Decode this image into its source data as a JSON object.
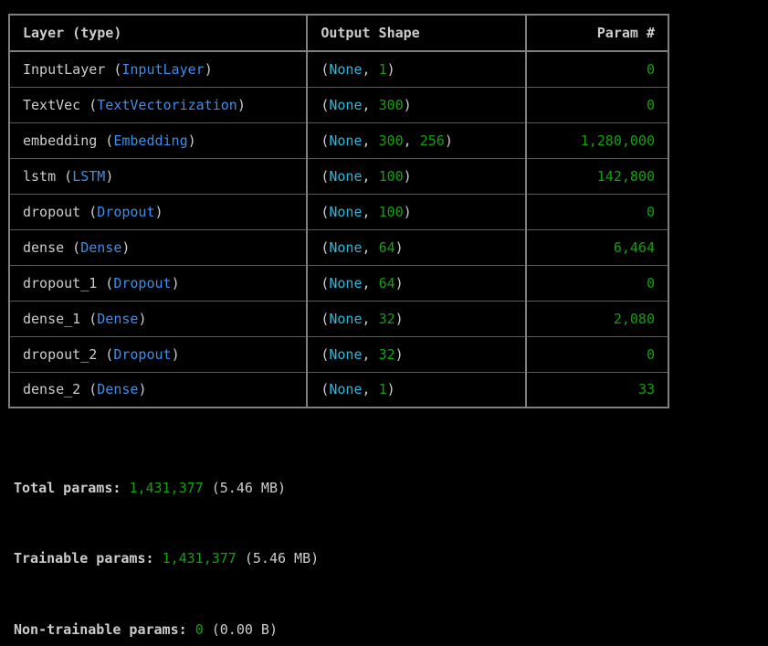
{
  "table": {
    "headers": {
      "layer": "Layer (type)",
      "shape": "Output Shape",
      "param": "Param #"
    },
    "rows": [
      {
        "name": "InputLayer",
        "type": "InputLayer",
        "shape": [
          "None",
          "1"
        ],
        "params": "0"
      },
      {
        "name": "TextVec",
        "type": "TextVectorization",
        "shape": [
          "None",
          "300"
        ],
        "params": "0"
      },
      {
        "name": "embedding",
        "type": "Embedding",
        "shape": [
          "None",
          "300",
          "256"
        ],
        "params": "1,280,000"
      },
      {
        "name": "lstm",
        "type": "LSTM",
        "shape": [
          "None",
          "100"
        ],
        "params": "142,800"
      },
      {
        "name": "dropout",
        "type": "Dropout",
        "shape": [
          "None",
          "100"
        ],
        "params": "0"
      },
      {
        "name": "dense",
        "type": "Dense",
        "shape": [
          "None",
          "64"
        ],
        "params": "6,464"
      },
      {
        "name": "dropout_1",
        "type": "Dropout",
        "shape": [
          "None",
          "64"
        ],
        "params": "0"
      },
      {
        "name": "dense_1",
        "type": "Dense",
        "shape": [
          "None",
          "32"
        ],
        "params": "2,080"
      },
      {
        "name": "dropout_2",
        "type": "Dropout",
        "shape": [
          "None",
          "32"
        ],
        "params": "0"
      },
      {
        "name": "dense_2",
        "type": "Dense",
        "shape": [
          "None",
          "1"
        ],
        "params": "33"
      }
    ]
  },
  "totals": {
    "total": {
      "label": "Total params:",
      "value": "1,431,377",
      "size": "(5.46 MB)"
    },
    "trainable": {
      "label": "Trainable params:",
      "value": "1,431,377",
      "size": "(5.46 MB)"
    },
    "non_trainable": {
      "label": "Non-trainable params:",
      "value": "0",
      "size": "(0.00 B)"
    }
  },
  "colors": {
    "background": "#000000",
    "text": "#cccccc",
    "layer_type": "#3b8eea",
    "none_keyword": "#29b8db",
    "number": "#13a10e",
    "border": "#7f7f7f"
  }
}
